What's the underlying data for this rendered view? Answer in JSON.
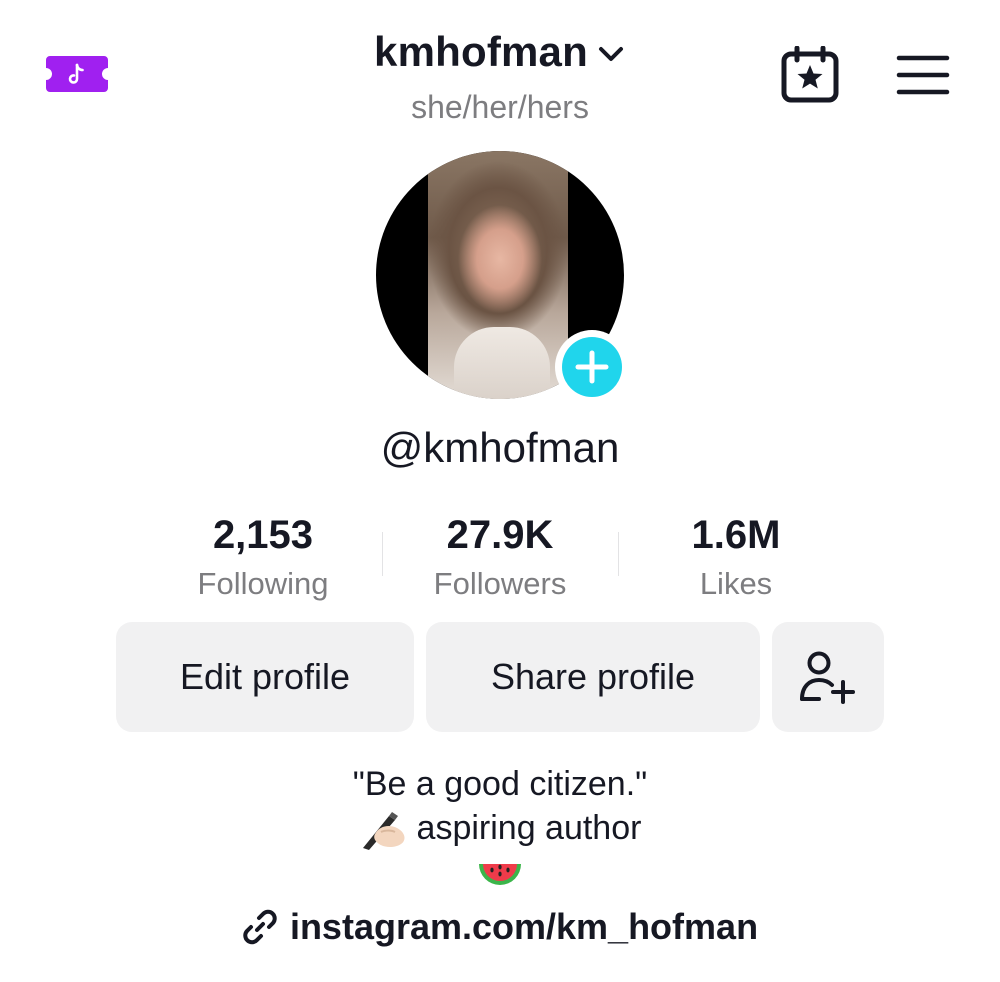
{
  "header": {
    "username": "kmhofman",
    "pronouns": "she/her/hers",
    "icons": {
      "promo": "tiktok-ticket-icon",
      "username_dropdown": "chevron-down-icon",
      "calendar": "calendar-star-icon",
      "menu": "hamburger-menu-icon"
    },
    "colors": {
      "promo_purple": "#a020f0"
    }
  },
  "profile": {
    "handle": "@kmhofman",
    "avatar_add_icon": "plus-icon",
    "colors": {
      "add_button": "#20d5ec"
    }
  },
  "stats": [
    {
      "value": "2,153",
      "label": "Following"
    },
    {
      "value": "27.9K",
      "label": "Followers"
    },
    {
      "value": "1.6M",
      "label": "Likes"
    }
  ],
  "actions": {
    "edit_label": "Edit profile",
    "share_label": "Share profile",
    "add_friend_icon": "add-user-icon"
  },
  "bio": {
    "line1": "\"Be a good citizen.\"",
    "line2": "aspiring author",
    "line2_icon": "writing-hand-icon",
    "line3_icon": "watermelon-icon"
  },
  "link": {
    "text": "instagram.com/km_hofman",
    "icon": "link-icon"
  }
}
